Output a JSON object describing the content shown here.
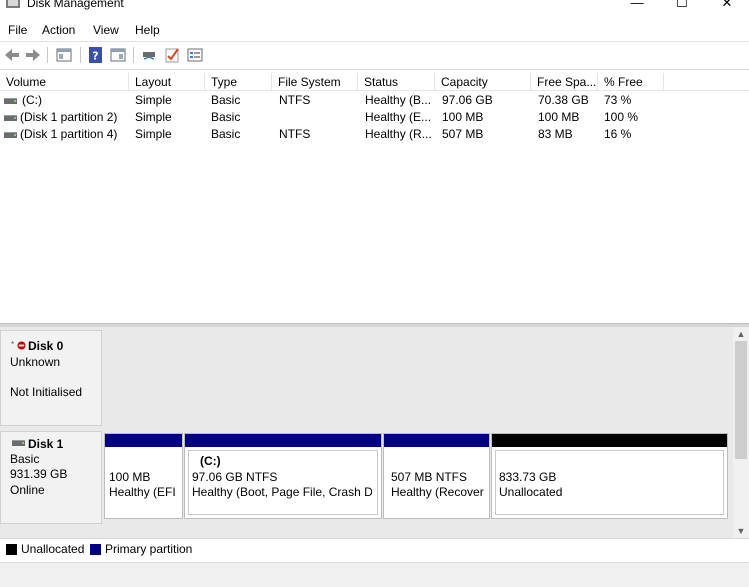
{
  "window": {
    "title": "Disk Management",
    "controls": {
      "minimize": "—",
      "maximize": "☐",
      "close": "✕"
    }
  },
  "menu": [
    "File",
    "Action",
    "View",
    "Help"
  ],
  "toolbar": {
    "icons": [
      "back-arrow-icon",
      "forward-arrow-icon",
      "properties-pane-icon",
      "help-icon",
      "console-tree-icon",
      "connect-drive-icon",
      "check-icon",
      "list-view-icon"
    ]
  },
  "volume_list": {
    "columns": [
      "Volume",
      "Layout",
      "Type",
      "File System",
      "Status",
      "Capacity",
      "Free Spa...",
      "% Free"
    ],
    "rows": [
      [
        "(C:)",
        "Simple",
        "Basic",
        "NTFS",
        "Healthy (B...",
        "97.06 GB",
        "70.38 GB",
        "73 %"
      ],
      [
        "(Disk 1 partition 2)",
        "Simple",
        "Basic",
        "",
        "Healthy (E...",
        "100 MB",
        "100 MB",
        "100 %"
      ],
      [
        "(Disk 1 partition 4)",
        "Simple",
        "Basic",
        "NTFS",
        "Healthy (R...",
        "507 MB",
        "83 MB",
        "16 %"
      ]
    ]
  },
  "disks": {
    "disk0": {
      "name": "Disk 0",
      "type": "Unknown",
      "state": "Not Initialised"
    },
    "disk1": {
      "name": "Disk 1",
      "type": "Basic",
      "size": "931.39 GB",
      "state": "Online",
      "partitions": [
        {
          "title": "",
          "line1": "100 MB",
          "line2": "Healthy (EFI",
          "bar": "#000080"
        },
        {
          "title": "(C:)",
          "line1": "97.06 GB NTFS",
          "line2": "Healthy (Boot, Page File, Crash Dur",
          "bar": "#000080"
        },
        {
          "title": "",
          "line1": "507 MB NTFS",
          "line2": "Healthy (Recover",
          "bar": "#000080"
        },
        {
          "title": "",
          "line1": "833.73 GB",
          "line2": "Unallocated",
          "bar": "#000000"
        }
      ]
    }
  },
  "legend": [
    {
      "label": "Unallocated",
      "color": "#000000"
    },
    {
      "label": "Primary partition",
      "color": "#000080"
    }
  ]
}
